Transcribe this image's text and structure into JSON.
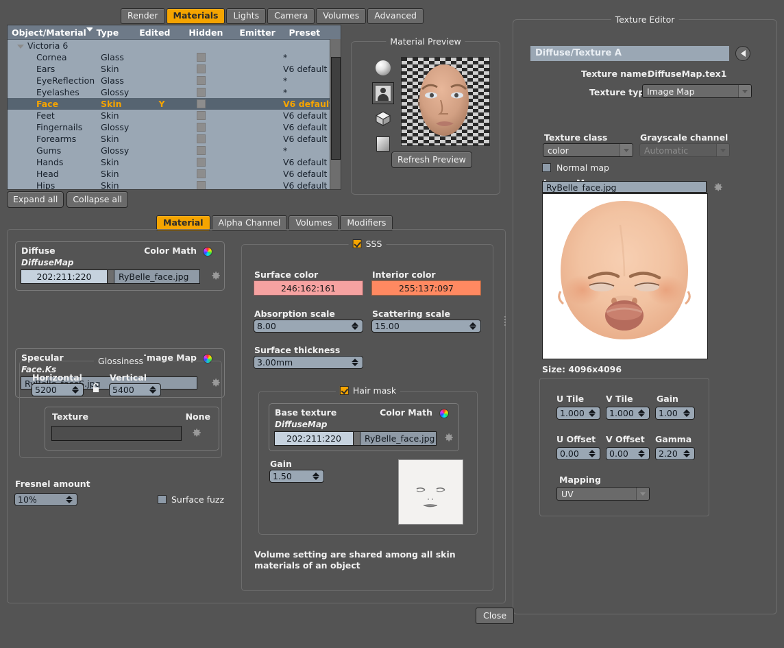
{
  "top_tabs": [
    {
      "label": "Render",
      "active": false
    },
    {
      "label": "Materials",
      "active": true
    },
    {
      "label": "Lights",
      "active": false
    },
    {
      "label": "Camera",
      "active": false
    },
    {
      "label": "Volumes",
      "active": false
    },
    {
      "label": "Advanced",
      "active": false
    }
  ],
  "material_list": {
    "columns": [
      "Object/Material",
      "Type",
      "Edited",
      "Hidden",
      "Emitter",
      "Preset"
    ],
    "sort_indicator": "descending",
    "rows": [
      {
        "name": "Victoria 6",
        "type": "",
        "edited": "",
        "hidden": false,
        "emitter": "",
        "preset": "",
        "root": true,
        "selected": false
      },
      {
        "name": "Cornea",
        "type": "Glass",
        "edited": "",
        "hidden": true,
        "emitter": "",
        "preset": "*",
        "root": false,
        "selected": false
      },
      {
        "name": "Ears",
        "type": "Skin",
        "edited": "",
        "hidden": true,
        "emitter": "",
        "preset": "V6 default",
        "root": false,
        "selected": false
      },
      {
        "name": "EyeReflection",
        "type": "Glass",
        "edited": "",
        "hidden": true,
        "emitter": "",
        "preset": "*",
        "root": false,
        "selected": false
      },
      {
        "name": "Eyelashes",
        "type": "Glossy",
        "edited": "",
        "hidden": true,
        "emitter": "",
        "preset": "*",
        "root": false,
        "selected": false
      },
      {
        "name": "Face",
        "type": "Skin",
        "edited": "Y",
        "hidden": true,
        "emitter": "",
        "preset": "V6 default",
        "root": false,
        "selected": true
      },
      {
        "name": "Feet",
        "type": "Skin",
        "edited": "",
        "hidden": true,
        "emitter": "",
        "preset": "V6 default",
        "root": false,
        "selected": false
      },
      {
        "name": "Fingernails",
        "type": "Glossy",
        "edited": "",
        "hidden": true,
        "emitter": "",
        "preset": "V6 default",
        "root": false,
        "selected": false
      },
      {
        "name": "Forearms",
        "type": "Skin",
        "edited": "",
        "hidden": true,
        "emitter": "",
        "preset": "V6 default",
        "root": false,
        "selected": false
      },
      {
        "name": "Gums",
        "type": "Glossy",
        "edited": "",
        "hidden": true,
        "emitter": "",
        "preset": "*",
        "root": false,
        "selected": false
      },
      {
        "name": "Hands",
        "type": "Skin",
        "edited": "",
        "hidden": true,
        "emitter": "",
        "preset": "V6 default",
        "root": false,
        "selected": false
      },
      {
        "name": "Head",
        "type": "Skin",
        "edited": "",
        "hidden": true,
        "emitter": "",
        "preset": "V6 default",
        "root": false,
        "selected": false
      },
      {
        "name": "Hips",
        "type": "Skin",
        "edited": "",
        "hidden": true,
        "emitter": "",
        "preset": "V6 default",
        "root": false,
        "selected": false
      }
    ],
    "expand_all": "Expand all",
    "collapse_all": "Collapse all"
  },
  "material_preview": {
    "title": "Material Preview",
    "shapes": [
      "sphere-icon",
      "bust-icon",
      "cube-icon",
      "plane-icon"
    ],
    "selected_shape": "bust-icon",
    "refresh_label": "Refresh Preview"
  },
  "texture_editor": {
    "title": "Texture Editor",
    "slot": "Diffuse/Texture A",
    "back_icon": "back-arrow-icon",
    "texture_name_label": "Texture name:",
    "texture_name_value": "DiffuseMap.tex1",
    "texture_type_label": "Texture type",
    "texture_type_value": "Image Map",
    "texture_class_label": "Texture class",
    "texture_class_value": "color",
    "grayscale_channel_label": "Grayscale channel",
    "grayscale_channel_value": "Automatic",
    "grayscale_disabled": true,
    "normal_map_label": "Normal map",
    "normal_map_checked": false,
    "image_map_label": "Image Map",
    "image_map_file": "RyBelle_face.jpg",
    "size_label": "Size: 4096x4096",
    "params": {
      "u_tile_label": "U Tile",
      "u_tile_value": "1.000",
      "v_tile_label": "V Tile",
      "v_tile_value": "1.000",
      "gain_label": "Gain",
      "gain_value": "1.00",
      "u_offset_label": "U Offset",
      "u_offset_value": "0.00",
      "v_offset_label": "V Offset",
      "v_offset_value": "0.00",
      "gamma_label": "Gamma",
      "gamma_value": "2.20",
      "mapping_label": "Mapping",
      "mapping_value": "UV"
    }
  },
  "mid_tabs": [
    {
      "label": "Material",
      "active": true
    },
    {
      "label": "Alpha Channel",
      "active": false
    },
    {
      "label": "Volumes",
      "active": false
    },
    {
      "label": "Modifiers",
      "active": false
    }
  ],
  "diffuse": {
    "title": "Diffuse",
    "mode": "Color Math",
    "map_name": "DiffuseMap",
    "color_value": "202:211:220",
    "file": "RyBelle_face.jpg",
    "gear_icon": "gear-icon",
    "wheel_icon": "color-wheel-icon"
  },
  "specular": {
    "title": "Specular",
    "mode": "Image Map",
    "map_name": "Face.Ks",
    "file": "RyBelle_faceS.jpg",
    "gear_icon": "gear-icon",
    "wheel_icon": "color-wheel-icon"
  },
  "glossiness": {
    "title": "Glossiness",
    "horizontal_label": "Horizontal",
    "horizontal_value": "5200",
    "vertical_label": "Vertical",
    "vertical_value": "5400",
    "lock_icon": "unlocked-padlock-icon",
    "texture_label": "Texture",
    "texture_value": "None",
    "texture_field": "",
    "gear_icon": "gear-icon"
  },
  "fresnel": {
    "label": "Fresnel amount",
    "value": "10%",
    "surface_fuzz_label": "Surface fuzz",
    "surface_fuzz_checked": false
  },
  "sss": {
    "title": "SSS",
    "enabled": true,
    "surface_color_label": "Surface color",
    "surface_color_value": "246:162:161",
    "surface_color_hex": "#f6a2a1",
    "interior_color_label": "Interior color",
    "interior_color_value": "255:137:097",
    "interior_color_hex": "#ff8961",
    "absorption_label": "Absorption scale",
    "absorption_value": "8.00",
    "scattering_label": "Scattering scale",
    "scattering_value": "15.00",
    "thickness_label": "Surface thickness",
    "thickness_value": "3.00mm"
  },
  "hair_mask": {
    "title": "Hair mask",
    "enabled": true,
    "base_texture_label": "Base texture",
    "mode": "Color Math",
    "map_name": "DiffuseMap",
    "color_value": "202:211:220",
    "file": "RyBelle_face.jpg",
    "gain_label": "Gain",
    "gain_value": "1.50",
    "gear_icon": "gear-icon",
    "wheel_icon": "color-wheel-icon"
  },
  "note": "Volume setting are shared among all skin materials of an object",
  "close_label": "Close",
  "colors": {
    "window_bg": "#545454",
    "accent": "#f5a400",
    "list_bg": "#9aa7b4",
    "list_header": "#6e7a88",
    "selected_row": "#566471",
    "field_bg": "#9aa7b4"
  }
}
